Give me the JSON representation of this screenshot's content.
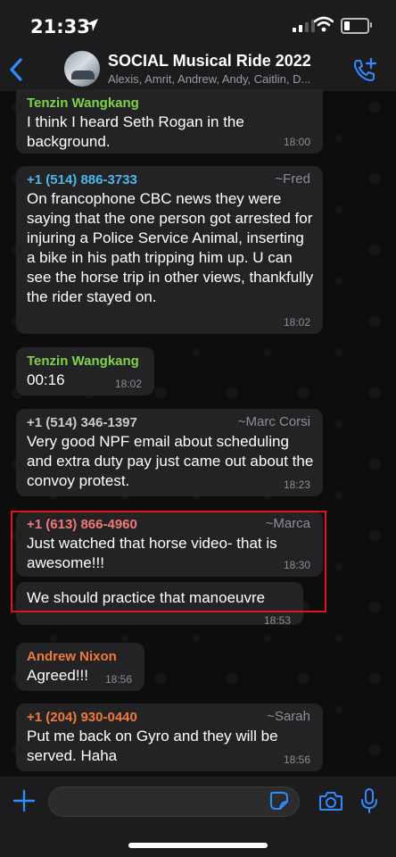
{
  "status": {
    "time": "21:33",
    "signal_bars_lit": 2,
    "battery_level": 0.2
  },
  "header": {
    "title": "SOCIAL Musical Ride 2022",
    "members": "Alexis, Amrit, Andrew, Andy, Caitlin, D..."
  },
  "messages": [
    {
      "sender": "Tenzin Wangkang",
      "sender_color": "#7fd34a",
      "alias": "",
      "text": "I think I heard Seth Rogan in the background.",
      "time": "18:00"
    },
    {
      "sender": "+1 (514) 886-3733",
      "sender_color": "#4fb6e8",
      "alias": "~Fred",
      "text": "On francophone CBC news they were saying that the one person got arrested for injuring a Police Service Animal, inserting a bike in his path tripping him up.  U can see the horse trip in other views, thankfully the rider stayed on.",
      "time": "18:02"
    },
    {
      "sender": "Tenzin Wangkang",
      "sender_color": "#7fd34a",
      "alias": "",
      "text": "00:16",
      "time": "18:02"
    },
    {
      "sender": "+1 (514) 346-1397",
      "sender_color": "#c9c9c9",
      "alias": "~Marc Corsi",
      "text": "Very good NPF email about scheduling and extra duty pay just came out about the convoy protest.",
      "time": "18:23"
    },
    {
      "sender": "+1 (613) 866-4960",
      "sender_color": "#f07a7a",
      "alias": "~Marca",
      "text": "Just watched that horse video- that is awesome!!!",
      "time": "18:30"
    },
    {
      "sender": "",
      "sender_color": "",
      "alias": "",
      "text": "We should practice that manoeuvre",
      "time": "18:53"
    },
    {
      "sender": "Andrew Nixon",
      "sender_color": "#f07a3a",
      "alias": "",
      "text": "Agreed!!!",
      "time": "18:56"
    },
    {
      "sender": "+1 (204) 930-0440",
      "sender_color": "#f07a3a",
      "alias": "~Sarah",
      "text": "Put me back on Gyro and they will be served. Haha",
      "time": "18:56"
    }
  ],
  "colors": {
    "accent": "#2f8cff",
    "bubble": "#232325",
    "highlight": "#e1141d"
  },
  "icons": [
    "location-arrow-icon",
    "wifi-icon",
    "battery-icon",
    "back-chevron-icon",
    "add-call-icon",
    "plus-icon",
    "sticker-icon",
    "camera-icon",
    "microphone-icon"
  ]
}
